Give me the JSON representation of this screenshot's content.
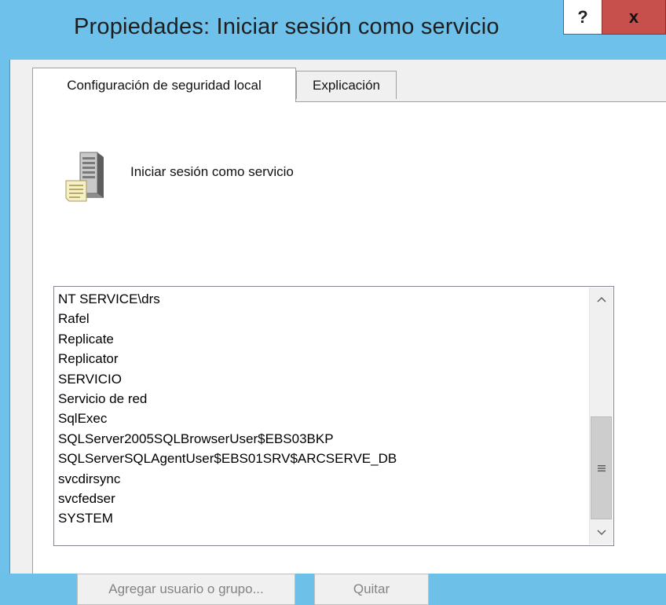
{
  "window": {
    "title": "Propiedades: Iniciar sesión como servicio",
    "help_label": "?",
    "close_label": "x"
  },
  "tabs": [
    {
      "label": "Configuración de seguridad local",
      "active": true
    },
    {
      "label": "Explicación",
      "active": false
    }
  ],
  "policy": {
    "icon": "server-document-icon",
    "name": "Iniciar sesión como servicio"
  },
  "accounts": [
    "NT SERVICE\\drs",
    "Rafel",
    "Replicate",
    "Replicator",
    "SERVICIO",
    "Servicio de red",
    "SqlExec",
    "SQLServer2005SQLBrowserUser$EBS03BKP",
    "SQLServerSQLAgentUser$EBS01SRV$ARCSERVE_DB",
    "svcdirsync",
    "svcfedser",
    "SYSTEM"
  ],
  "buttons": {
    "add_label": "Agregar usuario o grupo...",
    "remove_label": "Quitar"
  },
  "colors": {
    "title_bar": "#6ec1ea",
    "close_button": "#c7504d",
    "dialog_bg": "#f0f0f0"
  }
}
